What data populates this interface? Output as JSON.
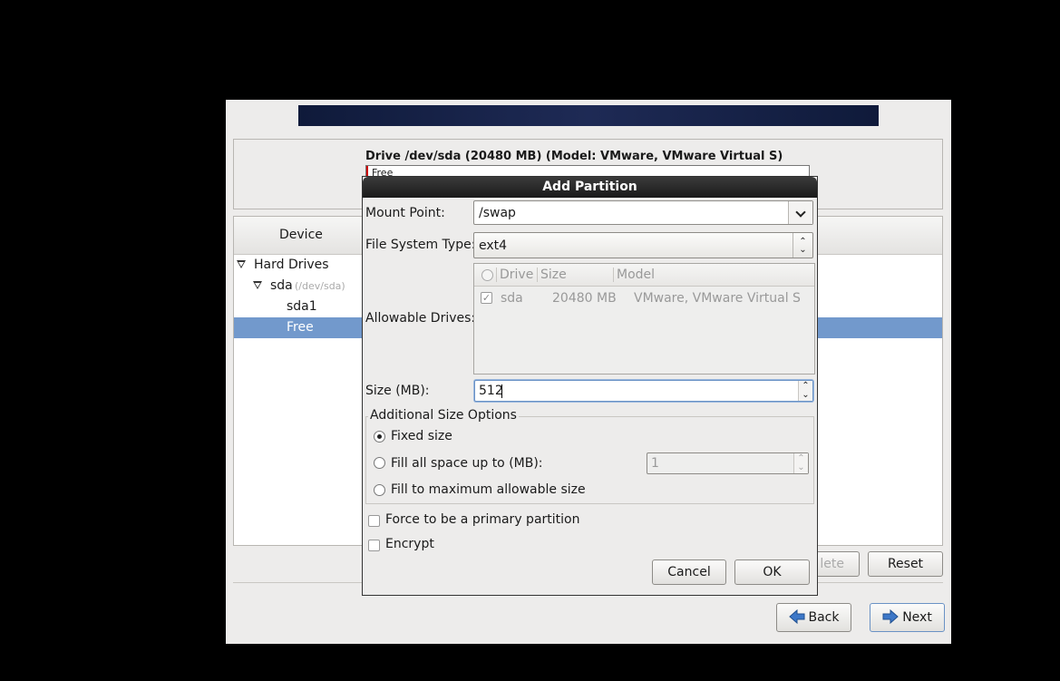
{
  "drive": {
    "title": "Drive /dev/sda (20480 MB) (Model: VMware, VMware Virtual S)",
    "bar_free_label": "Free"
  },
  "tree": {
    "column_device": "Device",
    "rows": [
      {
        "label": "Hard Drives"
      },
      {
        "label": "sda",
        "hint": "(/dev/sda)"
      },
      {
        "label": "sda1"
      },
      {
        "label": "Free"
      }
    ]
  },
  "main_buttons": {
    "delete": "lete",
    "reset": "Reset",
    "back": "Back",
    "next": "Next"
  },
  "dialog": {
    "title": "Add Partition",
    "mount_point_label": "Mount Point:",
    "mount_point_value": "/swap",
    "fs_type_label": "File System Type:",
    "fs_type_value": "ext4",
    "allowable_label": "Allowable Drives:",
    "drives_columns": [
      "Drive",
      "Size",
      "Model"
    ],
    "drives_rows": [
      {
        "checked": true,
        "drive": "sda",
        "size": "20480 MB",
        "model": "VMware, VMware Virtual S"
      }
    ],
    "size_label": "Size (MB):",
    "size_value": "512",
    "size_options_label": "Additional Size Options",
    "opt_fixed": "Fixed size",
    "opt_fill_upto": "Fill all space up to (MB):",
    "fill_upto_value": "1",
    "opt_fill_max": "Fill to maximum allowable size",
    "selected_option": "fixed",
    "force_primary": "Force to be a primary partition",
    "encrypt": "Encrypt",
    "cancel": "Cancel",
    "ok": "OK"
  },
  "colors": {
    "selection": "#7299cc",
    "dialog_title_bg": "#1a1a1a",
    "window_bg": "#edeceb",
    "arrow_blue": "#3d78c8"
  }
}
